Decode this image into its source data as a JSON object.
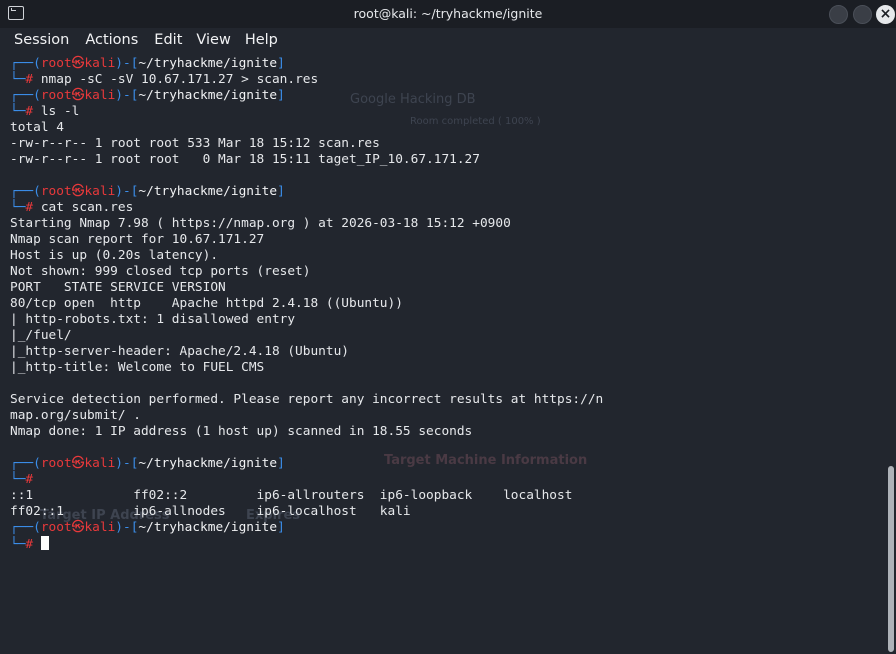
{
  "window": {
    "title": "root@kali: ~/tryhackme/ignite",
    "close_glyph": "×"
  },
  "menu": [
    "Session",
    "Actions",
    "Edit",
    "View",
    "Help"
  ],
  "prompt": {
    "corner_top": "┌──(",
    "user": "root",
    "at": "㉿",
    "host": "kali",
    "mid": ")-[",
    "path": "~/tryhackme/ignite",
    "close": "]",
    "corner_bottom": "└─",
    "symbol": "#"
  },
  "blocks": [
    {
      "command": " nmap -sC -sV 10.67.171.27 > scan.res",
      "output": []
    },
    {
      "command": " ls -l",
      "output": [
        "total 4",
        "-rw-r--r-- 1 root root 533 Mar 18 15:12 scan.res",
        "-rw-r--r-- 1 root root   0 Mar 18 15:11 taget_IP_10.67.171.27",
        ""
      ]
    },
    {
      "command": " cat scan.res",
      "output": [
        "Starting Nmap 7.98 ( https://nmap.org ) at 2026-03-18 15:12 +0900",
        "Nmap scan report for 10.67.171.27",
        "Host is up (0.20s latency).",
        "Not shown: 999 closed tcp ports (reset)",
        "PORT   STATE SERVICE VERSION",
        "80/tcp open  http    Apache httpd 2.4.18 ((Ubuntu))",
        "| http-robots.txt: 1 disallowed entry",
        "|_/fuel/",
        "|_http-server-header: Apache/2.4.18 (Ubuntu)",
        "|_http-title: Welcome to FUEL CMS",
        "",
        "Service detection performed. Please report any incorrect results at https://n",
        "map.org/submit/ .",
        "Nmap done: 1 IP address (1 host up) scanned in 18.55 seconds",
        ""
      ]
    },
    {
      "command": "",
      "output": [
        "::1             ff02::2         ip6-allrouters  ip6-loopback    localhost",
        "ff02::1         ip6-allnodes    ip6-localhost   kali"
      ]
    }
  ],
  "ghost_texts": [
    "Google Hacking DB",
    "Room completed ( 100% )",
    "Target Machine Information",
    "Target IP Address",
    "Expires"
  ]
}
